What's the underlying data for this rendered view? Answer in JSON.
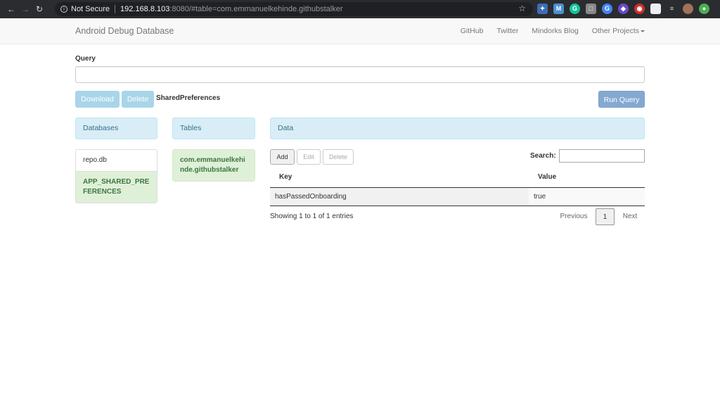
{
  "browser": {
    "not_secure": "Not Secure",
    "url_host": "192.168.8.103",
    "url_rest": ":8080/#table=com.emmanuelkehinde.githubstalker"
  },
  "navbar": {
    "brand": "Android Debug Database",
    "links": [
      "GitHub",
      "Twitter",
      "Mindorks Blog",
      "Other Projects"
    ]
  },
  "query": {
    "label": "Query",
    "value": ""
  },
  "actions": {
    "download": "Download",
    "delete": "Delete",
    "selected_type": "SharedPreferences",
    "run_query": "Run Query"
  },
  "databases": {
    "heading": "Databases",
    "items": [
      "repo.db",
      "APP_SHARED_PREFERENCES"
    ]
  },
  "tables": {
    "heading": "Tables",
    "items": [
      "com.emmanuelkehinde.githubstalker"
    ]
  },
  "data": {
    "heading": "Data",
    "add": "Add",
    "edit": "Edit",
    "delete": "Delete",
    "search_label": "Search:",
    "columns": [
      "Key",
      "Value"
    ],
    "rows": [
      [
        "hasPassedOnboarding",
        "true"
      ]
    ],
    "info": "Showing 1 to 1 of 1 entries",
    "pager": {
      "previous": "Previous",
      "page": "1",
      "next": "Next"
    }
  }
}
